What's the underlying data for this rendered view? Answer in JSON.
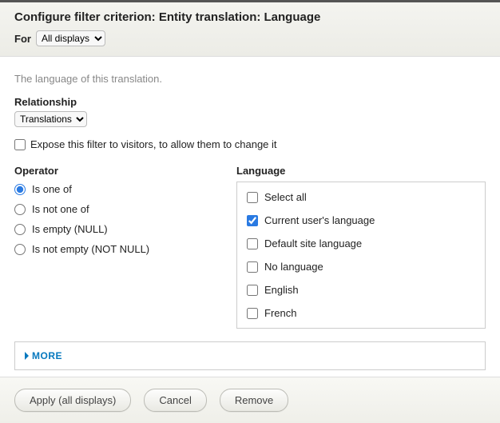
{
  "header": {
    "title": "Configure filter criterion: Entity translation: Language",
    "for_label": "For",
    "for_selected": "All displays"
  },
  "description": "The language of this translation.",
  "relationship": {
    "label": "Relationship",
    "selected": "Translations"
  },
  "expose": {
    "label": "Expose this filter to visitors, to allow them to change it",
    "checked": false
  },
  "operator": {
    "label": "Operator",
    "selected": 0,
    "options": [
      "Is one of",
      "Is not one of",
      "Is empty (NULL)",
      "Is not empty (NOT NULL)"
    ]
  },
  "language": {
    "label": "Language",
    "options": [
      {
        "label": "Select all",
        "checked": false
      },
      {
        "label": "Current user's language",
        "checked": true
      },
      {
        "label": "Default site language",
        "checked": false
      },
      {
        "label": "No language",
        "checked": false
      },
      {
        "label": "English",
        "checked": false
      },
      {
        "label": "French",
        "checked": false
      }
    ]
  },
  "more_label": "MORE",
  "buttons": {
    "apply": "Apply (all displays)",
    "cancel": "Cancel",
    "remove": "Remove"
  }
}
